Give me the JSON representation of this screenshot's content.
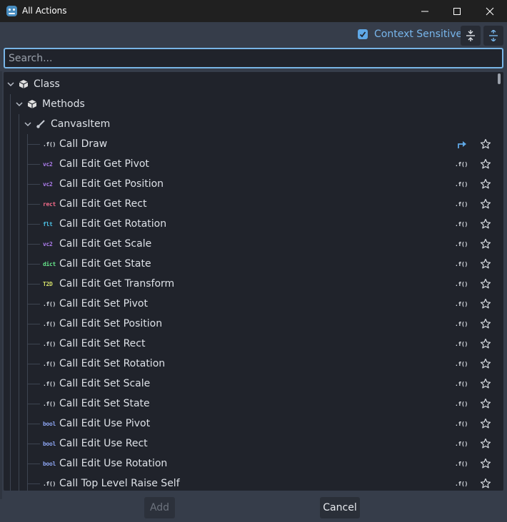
{
  "window": {
    "title": "All Actions",
    "app_icon": "godot-icon",
    "controls": {
      "minimize": "minimize-icon",
      "maximize": "maximize-icon",
      "close": "close-icon"
    }
  },
  "toolbar": {
    "context_sensitive_label": "Context Sensitive",
    "context_sensitive_checked": true,
    "collapse_icon": "collapse-all-icon",
    "expand_icon": "expand-all-icon"
  },
  "search": {
    "placeholder": "Search...",
    "value": ""
  },
  "tree": {
    "class_label": "Class",
    "methods_label": "Methods",
    "canvasitem_label": "CanvasItem",
    "items": [
      {
        "label": "Call Draw",
        "type": ".f()",
        "type_color": "#dde1e7",
        "action": "goto"
      },
      {
        "label": "Call Edit Get Pivot",
        "type": "vc2",
        "type_color": "#b07ef0",
        "action": "return"
      },
      {
        "label": "Call Edit Get Position",
        "type": "vc2",
        "type_color": "#b07ef0",
        "action": "return"
      },
      {
        "label": "Call Edit Get Rect",
        "type": "rect",
        "type_color": "#f26b8a",
        "action": "return"
      },
      {
        "label": "Call Edit Get Rotation",
        "type": "flt",
        "type_color": "#4cc2e6",
        "action": "return"
      },
      {
        "label": "Call Edit Get Scale",
        "type": "vc2",
        "type_color": "#b07ef0",
        "action": "return"
      },
      {
        "label": "Call Edit Get State",
        "type": "dict",
        "type_color": "#66e48a",
        "action": "return"
      },
      {
        "label": "Call Edit Get Transform",
        "type": "T2D",
        "type_color": "#d7e36a",
        "action": "return"
      },
      {
        "label": "Call Edit Set Pivot",
        "type": ".f()",
        "type_color": "#dde1e7",
        "action": "return"
      },
      {
        "label": "Call Edit Set Position",
        "type": ".f()",
        "type_color": "#dde1e7",
        "action": "return"
      },
      {
        "label": "Call Edit Set Rect",
        "type": ".f()",
        "type_color": "#dde1e7",
        "action": "return"
      },
      {
        "label": "Call Edit Set Rotation",
        "type": ".f()",
        "type_color": "#dde1e7",
        "action": "return"
      },
      {
        "label": "Call Edit Set Scale",
        "type": ".f()",
        "type_color": "#dde1e7",
        "action": "return"
      },
      {
        "label": "Call Edit Set State",
        "type": ".f()",
        "type_color": "#dde1e7",
        "action": "return"
      },
      {
        "label": "Call Edit Use Pivot",
        "type": "bool",
        "type_color": "#8da5f3",
        "action": "return"
      },
      {
        "label": "Call Edit Use Rect",
        "type": "bool",
        "type_color": "#8da5f3",
        "action": "return"
      },
      {
        "label": "Call Edit Use Rotation",
        "type": "bool",
        "type_color": "#8da5f3",
        "action": "return"
      },
      {
        "label": "Call Top Level Raise Self",
        "type": ".f()",
        "type_color": "#dde1e7",
        "action": "return"
      }
    ],
    "return_icon_text": ".f()"
  },
  "footer": {
    "add_label": "Add",
    "cancel_label": "Cancel"
  }
}
